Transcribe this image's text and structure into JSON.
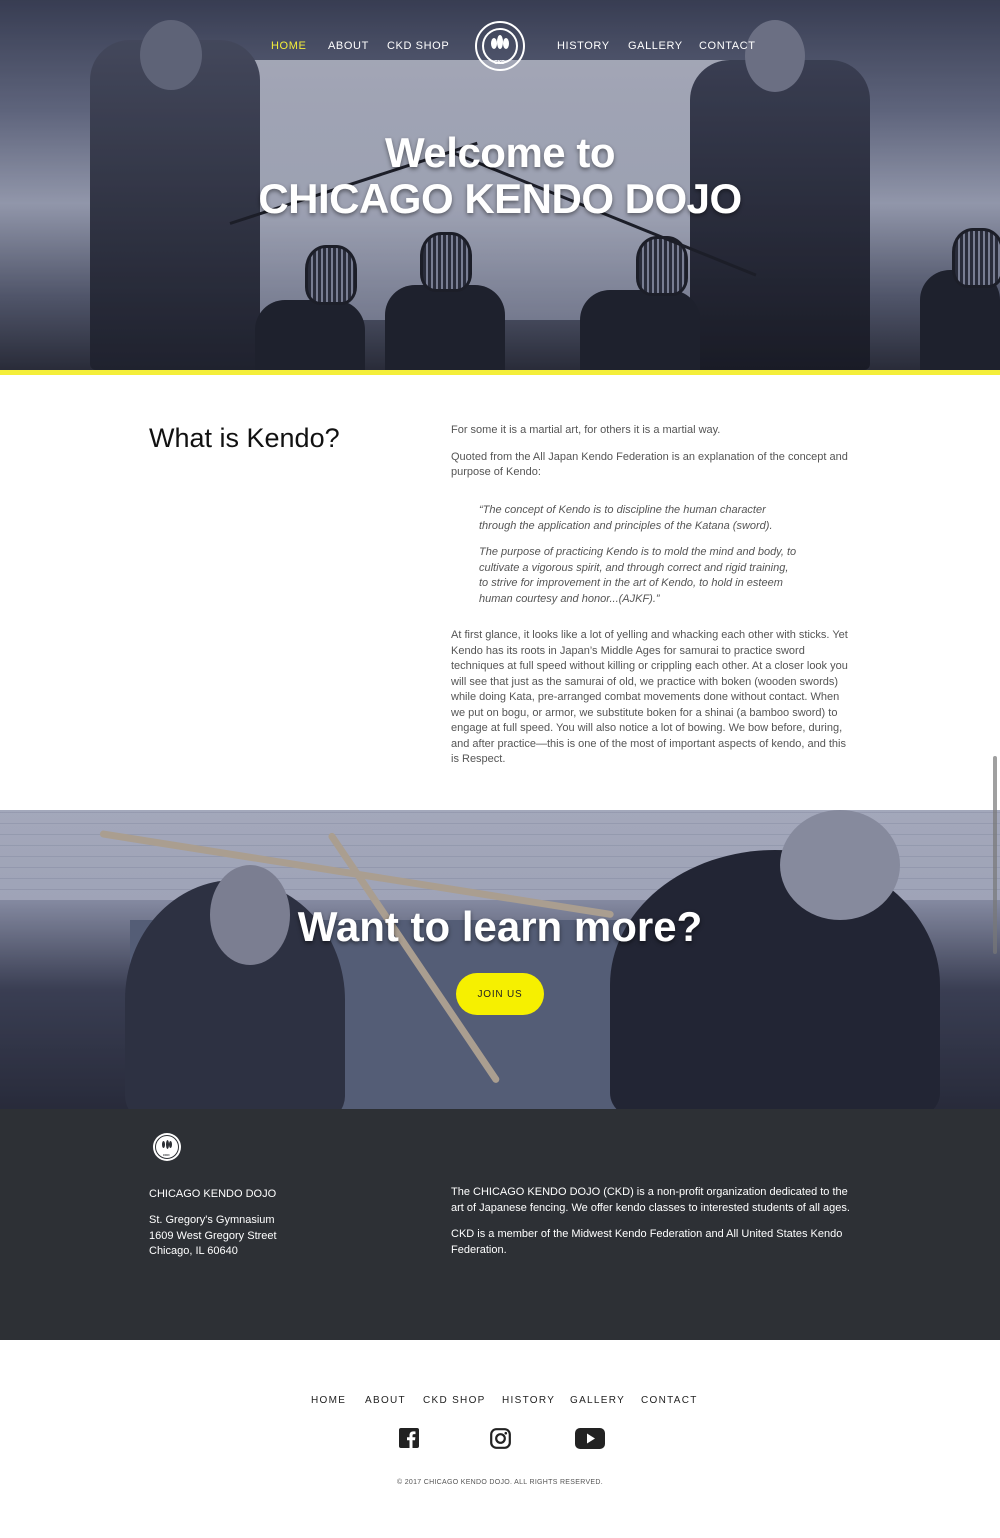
{
  "brand": {
    "name": "CHICAGO KENDO DOJO",
    "logo_icon": "ckd-crest-icon",
    "logo_tag": "CKD",
    "accent_color": "#f4ee3a",
    "button_color": "#f6f000",
    "footer_bg": "#2d3035"
  },
  "nav": {
    "items": [
      {
        "label": "HOME",
        "active": true
      },
      {
        "label": "ABOUT",
        "active": false
      },
      {
        "label": "CKD SHOP",
        "active": false
      },
      {
        "label": "HISTORY",
        "active": false
      },
      {
        "label": "GALLERY",
        "active": false
      },
      {
        "label": "CONTACT",
        "active": false
      }
    ]
  },
  "hero": {
    "line1": "Welcome to",
    "line2": "CHICAGO KENDO DOJO"
  },
  "kendo": {
    "title": "What is Kendo?",
    "intro1": "For some it is a martial art, for others it is a martial way.",
    "intro2": "Quoted from the All Japan Kendo Federation is an explanation of the concept and purpose of Kendo:",
    "quote1": "“The concept of Kendo is to discipline the human character through the application and principles of the Katana (sword).",
    "quote2": "The purpose of practicing Kendo is to mold the mind and body, to cultivate a vigorous spirit, and through correct and rigid training, to strive for improvement in the art of Kendo, to hold in esteem human courtesy and honor...(AJKF).”",
    "body": "At first glance, it looks like a lot of yelling and whacking each other with sticks. Yet Kendo has its roots in Japan’s Middle Ages for samurai to practice sword techniques at full speed without killing or crippling each other. At a closer look you will see that just as the samurai of old, we practice with boken (wooden swords) while doing Kata, pre-arranged combat movements done without contact. When we put on bogu, or armor, we substitute boken for a shinai (a bamboo sword) to engage at full speed. You will also notice a lot of bowing. We bow before, during, and after practice—this is one of the most of important aspects of kendo, and this is Respect."
  },
  "cta": {
    "title": "Want to learn more?",
    "button": "JOIN US"
  },
  "footer": {
    "org": "CHICAGO KENDO DOJO",
    "address": [
      "St. Gregory's Gymnasium",
      "1609 West Gregory Street",
      "Chicago, IL 60640"
    ],
    "about1": "The CHICAGO KENDO DOJO (CKD) is a non-profit organization dedicated to the art of Japanese fencing. We offer kendo classes to interested students of all ages.",
    "about2": "CKD is a member of the Midwest Kendo Federation and All United States Kendo Federation."
  },
  "bottom_nav": {
    "items": [
      "HOME",
      "ABOUT",
      "CKD SHOP",
      "HISTORY",
      "GALLERY",
      "CONTACT"
    ]
  },
  "social": {
    "icons": [
      "facebook-icon",
      "instagram-icon",
      "youtube-icon"
    ]
  },
  "copyright": "© 2017 CHICAGO KENDO DOJO. ALL RIGHTS RESERVED."
}
